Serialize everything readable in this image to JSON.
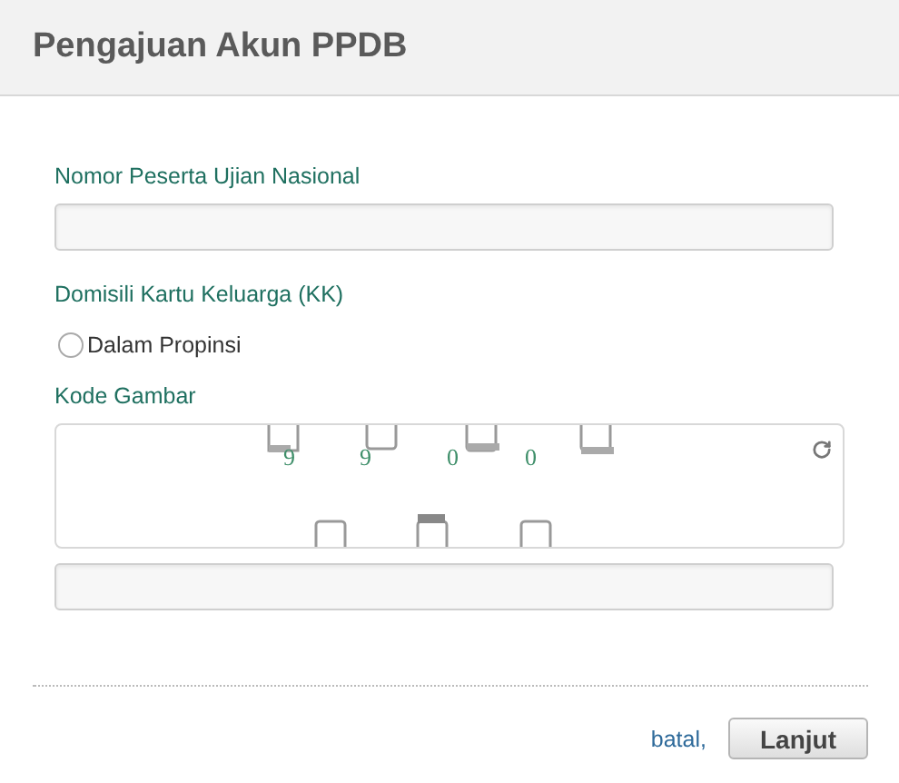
{
  "dialog": {
    "title": "Pengajuan Akun PPDB"
  },
  "fields": [
    {
      "kind": "text",
      "label": "Nomor Peserta Ujian Nasional"
    },
    {
      "kind": "radio",
      "label": "Domisili Kartu Keluarga (KK)",
      "options": [
        {
          "label": "Dalam Propinsi",
          "selected": false
        }
      ]
    },
    {
      "kind": "captcha",
      "label": "Kode Gambar",
      "characters": [
        "9",
        "9",
        "0",
        "0"
      ]
    },
    {
      "kind": "text"
    }
  ],
  "footer": {
    "cancel": "batal,",
    "submit": "Lanjut"
  }
}
